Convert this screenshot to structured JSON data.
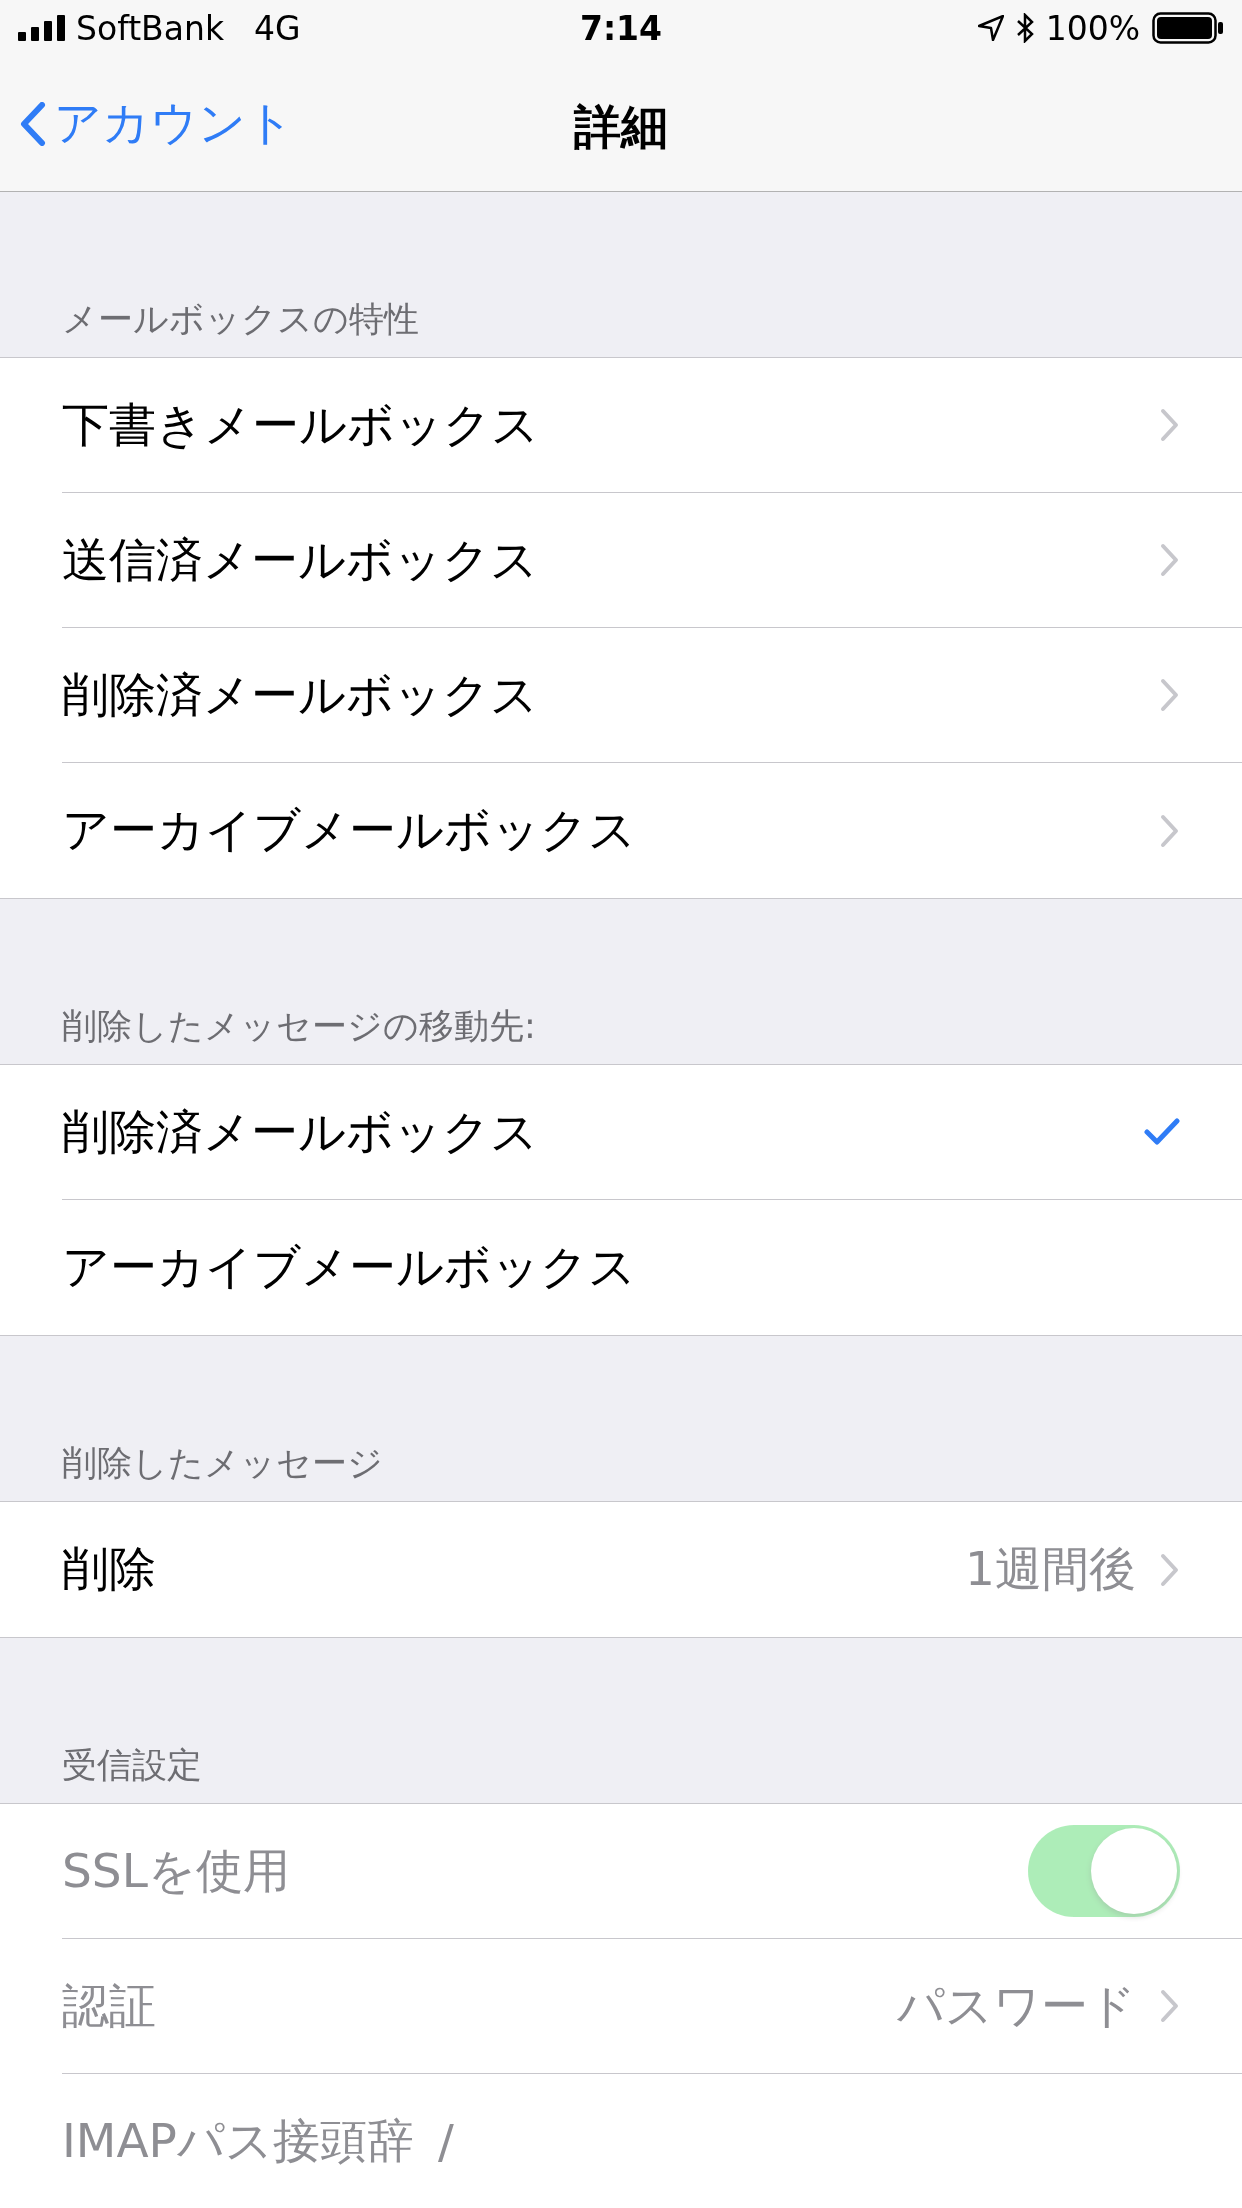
{
  "status_bar": {
    "carrier": "SoftBank",
    "network": "4G",
    "time": "7:14",
    "battery": "100%"
  },
  "nav": {
    "back": "アカウント",
    "title": "詳細"
  },
  "sections": [
    {
      "header": "メールボックスの特性",
      "rows": [
        {
          "kind": "link",
          "label": "下書きメールボックス",
          "disabled": false
        },
        {
          "kind": "link",
          "label": "送信済メールボックス",
          "disabled": false
        },
        {
          "kind": "link",
          "label": "削除済メールボックス",
          "disabled": false
        },
        {
          "kind": "link",
          "label": "アーカイブメールボックス",
          "disabled": false
        }
      ]
    },
    {
      "header": "削除したメッセージの移動先:",
      "rows": [
        {
          "kind": "choice",
          "label": "削除済メールボックス",
          "selected": true,
          "disabled": false
        },
        {
          "kind": "choice",
          "label": "アーカイブメールボックス",
          "selected": false,
          "disabled": false
        }
      ]
    },
    {
      "header": "削除したメッセージ",
      "rows": [
        {
          "kind": "link",
          "label": "削除",
          "value": "1週間後",
          "disabled": false
        }
      ]
    },
    {
      "header": "受信設定",
      "rows": [
        {
          "kind": "toggle",
          "label": "SSLを使用",
          "on": true,
          "disabled": true
        },
        {
          "kind": "link",
          "label": "認証",
          "value": "パスワード",
          "disabled": true
        },
        {
          "kind": "field",
          "label": "IMAPパス接頭辞",
          "value": "/",
          "disabled": true
        }
      ]
    }
  ]
}
